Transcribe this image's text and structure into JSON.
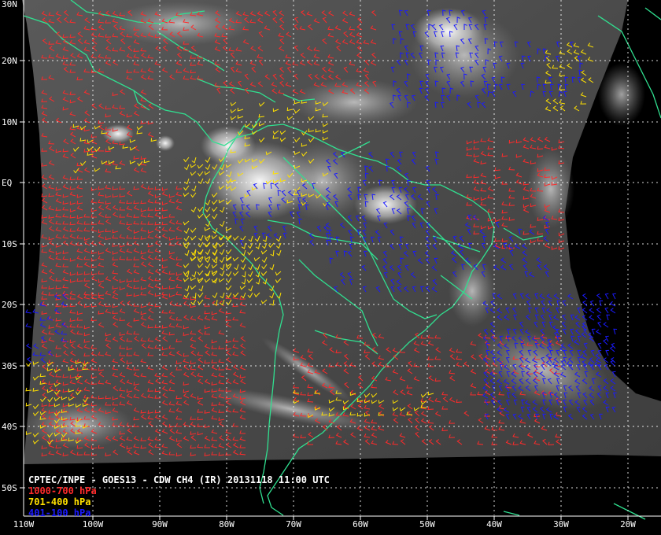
{
  "title": "CPTEC/INPE - GOES13 - CDW CH4 (IR) 20131118 11:00 UTC",
  "legend": [
    {
      "label": "1000-700 hPa",
      "color": "#ff2a2a"
    },
    {
      "label": "701-400 hPa",
      "color": "#ffe000"
    },
    {
      "label": "401-100 hPa",
      "color": "#1a1aff"
    }
  ],
  "lat_labels": [
    "30N",
    "20N",
    "10N",
    "EQ",
    "10S",
    "20S",
    "30S",
    "40S",
    "50S"
  ],
  "lon_labels": [
    "110W",
    "100W",
    "90W",
    "80W",
    "70W",
    "60W",
    "50W",
    "40W",
    "30W",
    "20W"
  ],
  "colors": {
    "background": "#000000",
    "coastline": "#30e090",
    "grid": "#ffffff",
    "label_text": "#ffffff"
  }
}
